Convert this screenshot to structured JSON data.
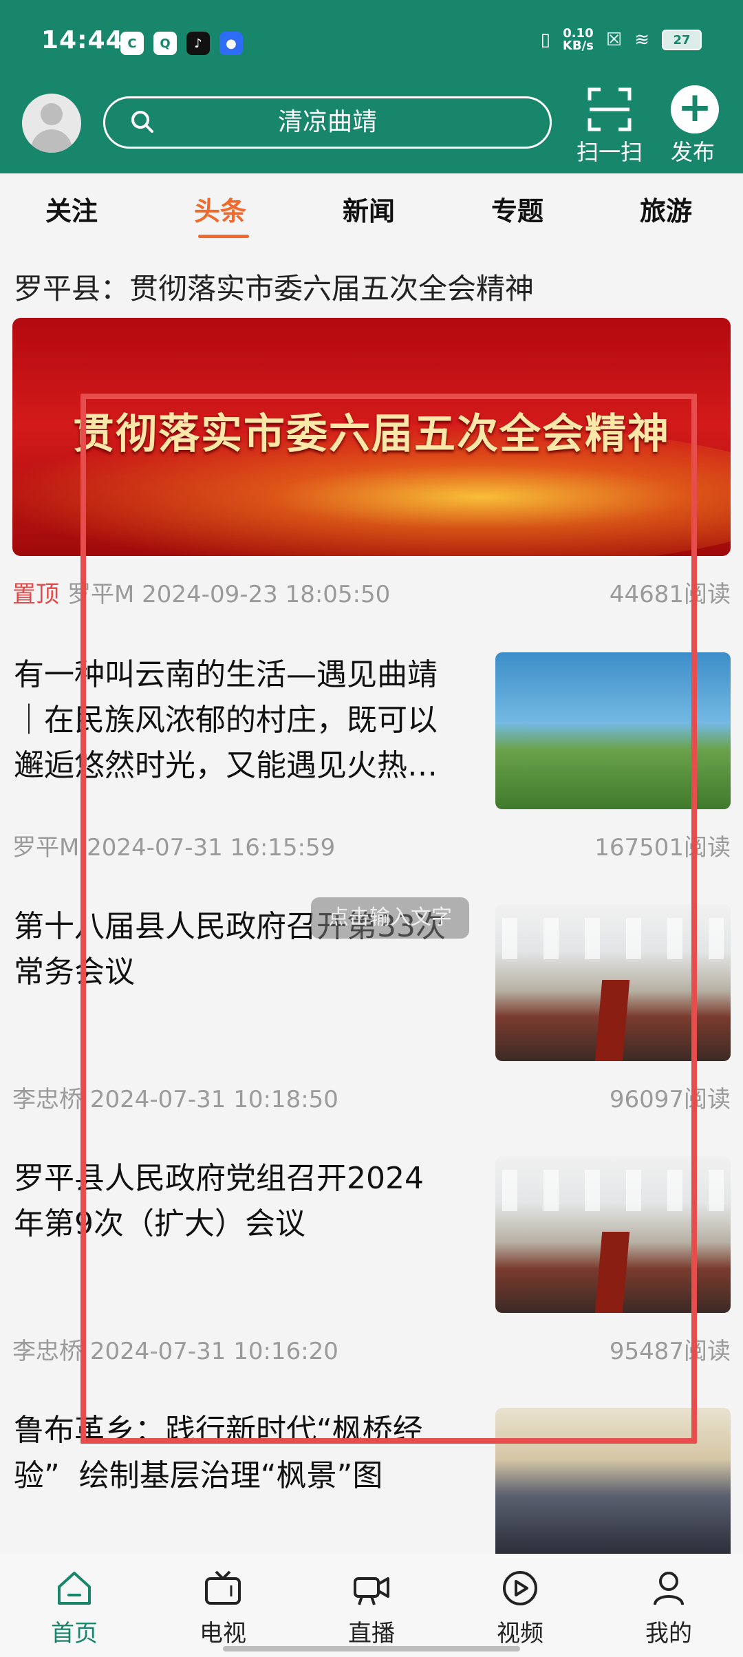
{
  "status_bar": {
    "time": "14:44",
    "network_speed": "0.10",
    "network_unit": "KB/s",
    "battery": "27",
    "app_icons": [
      "cc-app-icon",
      "qq-app-icon",
      "tiktok-icon",
      "browser-icon"
    ]
  },
  "header": {
    "search_text": "清凉曲靖",
    "scan_label": "扫一扫",
    "publish_label": "发布"
  },
  "tabs": [
    {
      "label": "关注",
      "active": false
    },
    {
      "label": "头条",
      "active": true
    },
    {
      "label": "新闻",
      "active": false
    },
    {
      "label": "专题",
      "active": false
    },
    {
      "label": "旅游",
      "active": false
    }
  ],
  "feed": {
    "featured": {
      "title": "罗平县：贯彻落实市委六届五次全会精神",
      "banner_text": "贯彻落实市委六届五次全会精神",
      "pinned_label": "置顶",
      "author": "罗平M",
      "date": "2024-09-23 18:05:50",
      "reads": "44681阅读"
    },
    "items": [
      {
        "title_lines": [
          "有一种叫云南的生活—遇见曲靖",
          "｜在民族风浓郁的村庄，既可以",
          "邂逅悠然时光，又能遇见火热…"
        ],
        "author": "罗平M",
        "date": "2024-07-31 16:15:59",
        "reads": "167501阅读"
      },
      {
        "title_lines": [
          "第十八届县人民政府召开第33次",
          "常务会议"
        ],
        "author": "李忠桥",
        "date": "2024-07-31 10:18:50",
        "reads": "96097阅读"
      },
      {
        "title_lines": [
          "罗平县人民政府党组召开2024",
          "年第9次（扩大）会议"
        ],
        "author": "李忠桥",
        "date": "2024-07-31 10:16:20",
        "reads": "95487阅读"
      },
      {
        "title_lines": [
          "鲁布革乡：践行新时代“枫桥经",
          "验”  绘制基层治理“枫景”图"
        ]
      }
    ],
    "overlay_tooltip": "点击输入文字"
  },
  "bottom_nav": [
    {
      "label": "首页",
      "icon": "home-icon",
      "active": true
    },
    {
      "label": "电视",
      "icon": "tv-icon",
      "active": false
    },
    {
      "label": "直播",
      "icon": "live-camera-icon",
      "active": false
    },
    {
      "label": "视频",
      "icon": "play-icon",
      "active": false
    },
    {
      "label": "我的",
      "icon": "person-icon",
      "active": false
    }
  ],
  "colors": {
    "brand_green": "#17866a",
    "accent_orange": "#ef6a2c",
    "pinned_red": "#e44848",
    "highlight_red": "#e84d4d"
  }
}
